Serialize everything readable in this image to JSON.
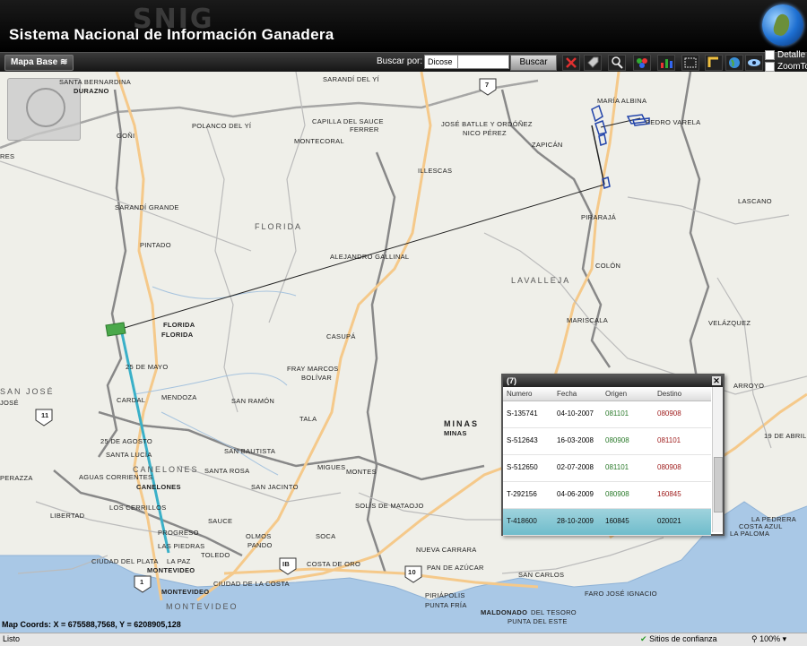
{
  "header": {
    "watermark": "SNIG",
    "title": "Sistema Nacional de Información Ganadera",
    "options": [
      "Detalle",
      "ZoomTo"
    ]
  },
  "toolbar": {
    "mapbase_label": "Mapa Base",
    "search_label": "Buscar por:",
    "search_type": "Dicose",
    "search_value": "",
    "search_button": "Buscar",
    "tools": [
      "clear-icon",
      "tag-icon",
      "identify-icon",
      "layers-icon",
      "grid-icon",
      "select-box-icon",
      "measure-icon",
      "globe-icon",
      "eye-icon"
    ]
  },
  "map": {
    "departments": [
      "FLORIDA",
      "LAVALLEJA",
      "CANELONES",
      "MINAS",
      "MONTEVIDEO",
      "SAN JOSÉ"
    ],
    "places": [
      "SANTA BERNARDINA",
      "DURAZNO",
      "SARANDÍ DEL YÍ",
      "MARÍA ALBINA",
      "JOSÉ BATLLE Y ORDÓÑEZ",
      "NICO PÉREZ",
      "PEDRO VARELA",
      "CAPILLA DEL SAUCE",
      "FERRER",
      "POLANCO DEL YÍ",
      "MONTECORAL",
      "ZAPICÁN",
      "ILLESCAS",
      "PIRARAJÁ",
      "LASCANO",
      "SARANDÍ GRANDE",
      "PINTADO",
      "ALEJANDRO GALLINAL",
      "COLÓN",
      "FLORIDA",
      "FLORIDA",
      "CASUPÁ",
      "MARISCALA",
      "VELÁZQUEZ",
      "25 DE MAYO",
      "FRAY MARCOS",
      "BOLÍVAR",
      "CARDAL",
      "MENDOZA",
      "SAN RAMÓN",
      "TALA",
      "25 DE AGOSTO",
      "SANTA LUCÍA",
      "SAN BAUTISTA",
      "SANTA ROSA",
      "MIGUES",
      "MONTES",
      "AGUAS CORRIENTES",
      "SAN JACINTO",
      "SOLÍS DE MATAOJO",
      "LOS CERRILLOS",
      "LIBERTAD",
      "PROGRESO",
      "SAUCE",
      "OLMOS",
      "PANDO",
      "SOCA",
      "LAS PIEDRAS",
      "TOLEDO",
      "NUEVA CARRARA",
      "CIUDAD DEL PLATA",
      "LA PAZ",
      "COSTA DE ORO",
      "PAN DE AZÚCAR",
      "SAN CARLOS",
      "CIUDAD DE LA COSTA",
      "PIRIÁPOLIS",
      "PUNTA FRÍA",
      "FARO JOSÉ IGNACIO",
      "MALDONADO",
      "DEL TESORO",
      "PUNTA DEL ESTE",
      "LA PEDRERA",
      "COSTA AZUL",
      "LA PALOMA",
      "19 DE ABRIL",
      "MONTEVIDEO",
      "MONTEVIDEO",
      "ARROYO",
      "RES",
      "JOSÉ",
      "PERAZZA",
      "GOÑI",
      "CANELONES",
      "MINAS"
    ],
    "route_shields": [
      "7",
      "11",
      "1",
      "IB",
      "10"
    ]
  },
  "coords": {
    "label": "Map Coords:",
    "x": "675588,7568",
    "y": "6208905,128",
    "text": "Map Coords: X = 675588,7568, Y = 6208905,128"
  },
  "status": {
    "left": "Listo",
    "trust": "Sitios de confianza",
    "zoom": "100%"
  },
  "popup": {
    "title": "(7)",
    "columns": [
      "Numero",
      "Fecha",
      "Origen",
      "Destino"
    ],
    "rows": [
      [
        "S-135741",
        "04-10-2007",
        "081101",
        "080908"
      ],
      [
        "S-512643",
        "16-03-2008",
        "080908",
        "081101"
      ],
      [
        "S-512650",
        "02-07-2008",
        "081101",
        "080908"
      ],
      [
        "T-292156",
        "04-06-2009",
        "080908",
        "160845"
      ],
      [
        "T-418600",
        "28-10-2009",
        "160845",
        "020021"
      ]
    ]
  },
  "colors": {
    "header_bg": "#000000",
    "map_bg": "#efefe9",
    "water": "#a9c8e6",
    "road": "#f5d9a8",
    "selected_row": "#6fbccb",
    "movement_line_teal": "#3ab0c8"
  }
}
